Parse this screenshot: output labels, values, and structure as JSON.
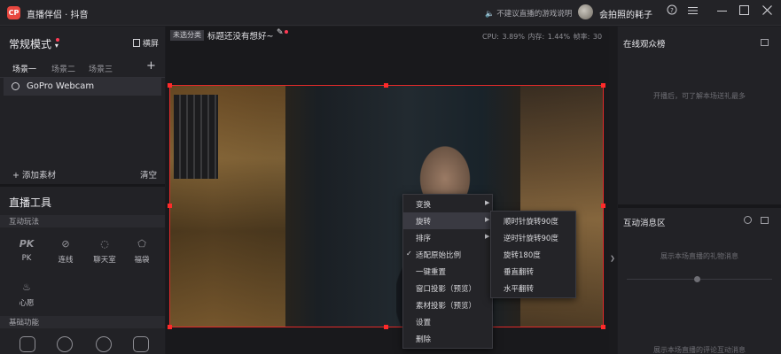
{
  "app": {
    "logo_text": "CP",
    "title": "直播伴侣 · 抖音",
    "notice": "不建议直播的游戏说明",
    "username": "会拍照的耗子",
    "icons": [
      "help-icon",
      "menu-icon",
      "minimize-icon",
      "maximize-icon",
      "close-icon"
    ]
  },
  "left": {
    "mode_label": "常规模式",
    "landscape_label": "横屏",
    "scenes": [
      "场景一",
      "场景二",
      "场景三"
    ],
    "scene_add": "+",
    "source_name": "GoPro Webcam",
    "add_source": "+ 添加素材",
    "clear": "清空",
    "tools_title": "直播工具",
    "interactive_header": "互动玩法",
    "tools": [
      {
        "label": "PK",
        "icon": "pk-icon"
      },
      {
        "label": "连线",
        "icon": "link-icon"
      },
      {
        "label": "聊天室",
        "icon": "chatroom-icon"
      },
      {
        "label": "福袋",
        "icon": "luckybag-icon"
      },
      {
        "label": "心愿",
        "icon": "wish-icon"
      }
    ],
    "basic_header": "基础功能"
  },
  "center": {
    "category": "未选分类",
    "stream_title": "标题还没有想好~",
    "stats": "CPU: 3.89%   内存: 1.44%   帧率: 30"
  },
  "context_menu": {
    "items": [
      "变换",
      "旋转",
      "排序",
      "适配原始比例",
      "一键重置",
      "窗口投影（预览）",
      "素材投影（预览）",
      "设置",
      "删除"
    ],
    "submenu": [
      "顺时针旋转90度",
      "逆时针旋转90度",
      "旋转180度",
      "垂直翻转",
      "水平翻转"
    ]
  },
  "right": {
    "viewers_title": "在线观众榜",
    "viewers_empty": "开播后，可了解本场送礼最多",
    "messages_title": "互动消息区",
    "gifts_empty": "展示本场直播的礼物消息",
    "comments_empty": "展示本场直播的评论互动消息"
  },
  "colors": {
    "accent": "#e8473f",
    "selection_border": "#e12a2a",
    "badge_dot": "#ff3b55"
  }
}
